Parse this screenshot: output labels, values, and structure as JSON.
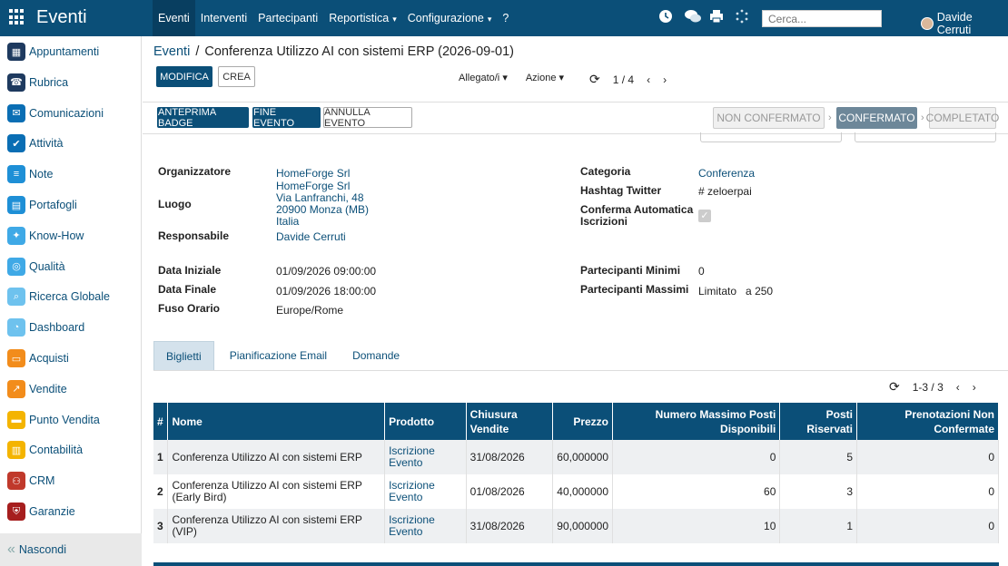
{
  "app": {
    "title": "Eventi"
  },
  "topmenu": [
    {
      "label": "Eventi"
    },
    {
      "label": "Interventi"
    },
    {
      "label": "Partecipanti"
    },
    {
      "label": "Reportistica",
      "caret": "▾"
    },
    {
      "label": "Configurazione",
      "caret": "▾"
    },
    {
      "label": "?"
    }
  ],
  "search": {
    "placeholder": "Cerca..."
  },
  "user": {
    "name": "Davide Cerruti"
  },
  "sidebar": {
    "items": [
      {
        "label": "Appuntamenti",
        "color": "#1e3a5f",
        "icon": "calendar-icon",
        "glyph": "▦"
      },
      {
        "label": "Rubrica",
        "color": "#1e3a5f",
        "icon": "contacts-icon",
        "glyph": "☎"
      },
      {
        "label": "Comunicazioni",
        "color": "#0a6eb4",
        "icon": "chat-icon",
        "glyph": "✉"
      },
      {
        "label": "Attività",
        "color": "#0a6eb4",
        "icon": "check-icon",
        "glyph": "✔"
      },
      {
        "label": "Note",
        "color": "#1e8fd6",
        "icon": "note-icon",
        "glyph": "≡"
      },
      {
        "label": "Portafogli",
        "color": "#1e8fd6",
        "icon": "folder-icon",
        "glyph": "▤"
      },
      {
        "label": "Know-How",
        "color": "#3fa9e6",
        "icon": "brain-icon",
        "glyph": "✦"
      },
      {
        "label": "Qualità",
        "color": "#3fa9e6",
        "icon": "quality-icon",
        "glyph": "◎"
      },
      {
        "label": "Ricerca Globale",
        "color": "#6ec2ee",
        "icon": "search-icon",
        "glyph": "⌕"
      },
      {
        "label": "Dashboard",
        "color": "#6ec2ee",
        "icon": "dashboard-icon",
        "glyph": "◔"
      },
      {
        "label": "Acquisti",
        "color": "#f28c1b",
        "icon": "cart-icon",
        "glyph": "▭"
      },
      {
        "label": "Vendite",
        "color": "#f28c1b",
        "icon": "chart-icon",
        "glyph": "↗"
      },
      {
        "label": "Punto Vendita",
        "color": "#f4b400",
        "icon": "pos-icon",
        "glyph": "▬"
      },
      {
        "label": "Contabilità",
        "color": "#f4b400",
        "icon": "accounting-icon",
        "glyph": "▥"
      },
      {
        "label": "CRM",
        "color": "#c0392b",
        "icon": "handshake-icon",
        "glyph": "⚇"
      },
      {
        "label": "Garanzie",
        "color": "#a61e1e",
        "icon": "shield-icon",
        "glyph": "⛨"
      }
    ],
    "hide_label": "Nascondi"
  },
  "breadcrumb": {
    "parent": "Eventi",
    "separator": "/",
    "current": "Conferenza Utilizzo AI con sistemi ERP (2026-09-01)"
  },
  "toolbar": {
    "edit_label": "MODIFICA",
    "create_label": "CREA",
    "attachments_label": "Allegato/i",
    "action_label": "Azione",
    "pager": "1 / 4"
  },
  "header_buttons": {
    "badge_preview": "ANTEPRIMA BADGE",
    "end_event": "FINE EVENTO",
    "cancel_event": "ANNULLA EVENTO"
  },
  "statusbar": {
    "not_confirmed": "NON CONFERMATO",
    "confirmed": "CONFERMATO",
    "completed": "COMPLETATO"
  },
  "form": {
    "organizer_label": "Organizzatore",
    "organizer": "HomeForge Srl",
    "location_label": "Luogo",
    "location_lines": [
      "HomeForge Srl",
      "Via Lanfranchi, 48",
      "20900 Monza (MB)",
      "Italia"
    ],
    "responsible_label": "Responsabile",
    "responsible": "Davide Cerruti",
    "category_label": "Categoria",
    "category": "Conferenza",
    "hashtag_label": "Hashtag Twitter",
    "hashtag_prefix": "#",
    "hashtag": "zeloerpai",
    "auto_confirm_label_1": "Conferma Automatica",
    "auto_confirm_label_2": "Iscrizioni",
    "auto_confirm": true,
    "start_label": "Data Iniziale",
    "start": "01/09/2026 09:00:00",
    "end_label": "Data Finale",
    "end": "01/09/2026 18:00:00",
    "tz_label": "Fuso Orario",
    "tz": "Europe/Rome",
    "min_label": "Partecipanti Minimi",
    "min": "0",
    "max_label": "Partecipanti Massimi",
    "max_mode": "Limitato",
    "max_prefix": "a",
    "max": "250"
  },
  "tabs": [
    {
      "label": "Biglietti"
    },
    {
      "label": "Pianificazione Email"
    },
    {
      "label": "Domande"
    }
  ],
  "table": {
    "pager": "1-3 / 3",
    "headers": [
      "#",
      "Nome",
      "Prodotto",
      "Chiusura Vendite",
      "Prezzo",
      "Numero Massimo Posti Disponibili",
      "Posti Riservati",
      "Prenotazioni Non Confermate"
    ],
    "rows": [
      {
        "n": "1",
        "name": "Conferenza Utilizzo AI con sistemi ERP",
        "product": "Iscrizione Evento",
        "close": "31/08/2026",
        "price": "60,000000",
        "max": "0",
        "reserved": "5",
        "unconfirmed": "0"
      },
      {
        "n": "2",
        "name": "Conferenza Utilizzo AI con sistemi ERP (Early Bird)",
        "product": "Iscrizione Evento",
        "close": "01/08/2026",
        "price": "40,000000",
        "max": "60",
        "reserved": "3",
        "unconfirmed": "0"
      },
      {
        "n": "3",
        "name": "Conferenza Utilizzo AI con sistemi ERP (VIP)",
        "product": "Iscrizione Evento",
        "close": "31/08/2026",
        "price": "90,000000",
        "max": "10",
        "reserved": "1",
        "unconfirmed": "0"
      }
    ]
  }
}
